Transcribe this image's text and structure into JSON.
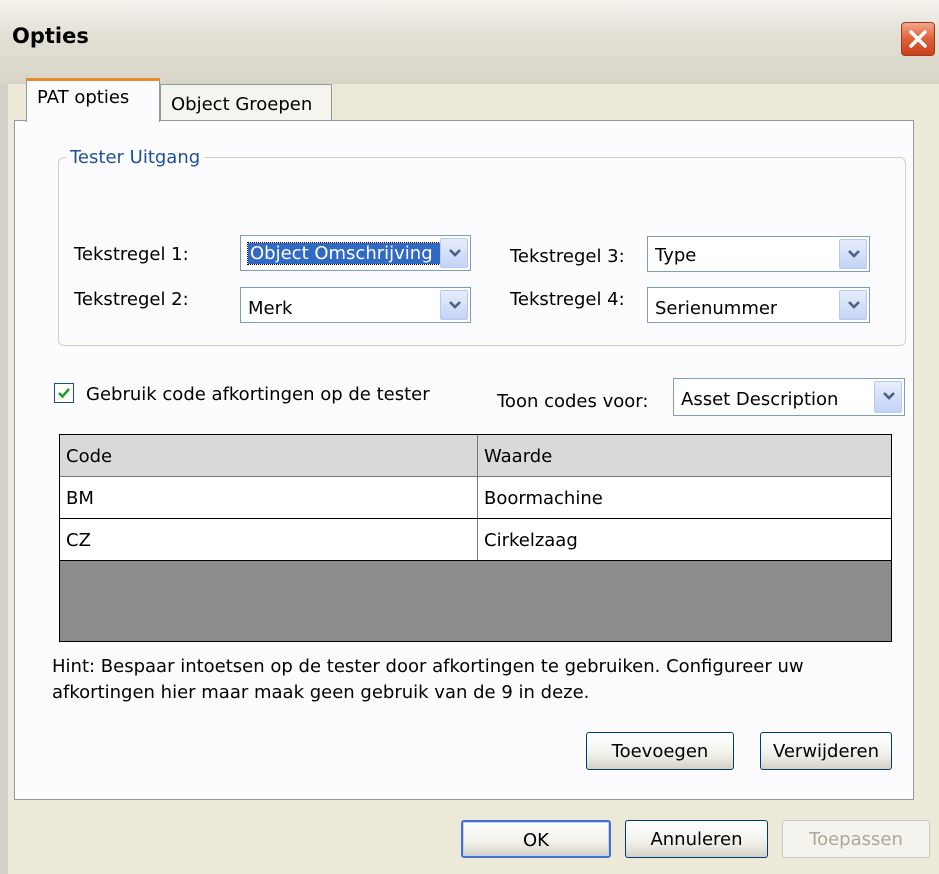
{
  "window": {
    "title": "Opties"
  },
  "tabs": [
    {
      "label": "PAT opties",
      "active": true
    },
    {
      "label": "Object Groepen",
      "active": false
    }
  ],
  "tester_output": {
    "group_label": "Tester Uitgang",
    "lines": [
      {
        "label": "Tekstregel 1:",
        "value": "Object Omschrijving"
      },
      {
        "label": "Tekstregel 2:",
        "value": "Merk"
      },
      {
        "label": "Tekstregel 3:",
        "value": "Type"
      },
      {
        "label": "Tekstregel 4:",
        "value": "Serienummer"
      }
    ]
  },
  "abbreviations": {
    "checkbox_label": "Gebruik code afkortingen op de tester",
    "checked": true,
    "show_codes_label": "Toon codes voor:",
    "show_codes_value": "Asset Description"
  },
  "table": {
    "columns": [
      "Code",
      "Waarde"
    ],
    "rows": [
      [
        "BM",
        "Boormachine"
      ],
      [
        "CZ",
        "Cirkelzaag"
      ]
    ]
  },
  "hint": "Hint: Bespaar intoetsen op de tester door afkortingen te gebruiken. Configureer uw afkortingen hier maar maak geen gebruik van de 9 in deze.",
  "buttons": {
    "add": "Toevoegen",
    "remove": "Verwijderen",
    "ok": "OK",
    "cancel": "Annuleren",
    "apply": "Toepassen"
  },
  "icons": {
    "close": "close-icon",
    "dropdown": "chevron-down-icon",
    "check": "checkmark-icon"
  },
  "colors": {
    "accent_tab": "#e68b2c",
    "group_title": "#1f4f9c",
    "close_button": "#e2643e"
  }
}
